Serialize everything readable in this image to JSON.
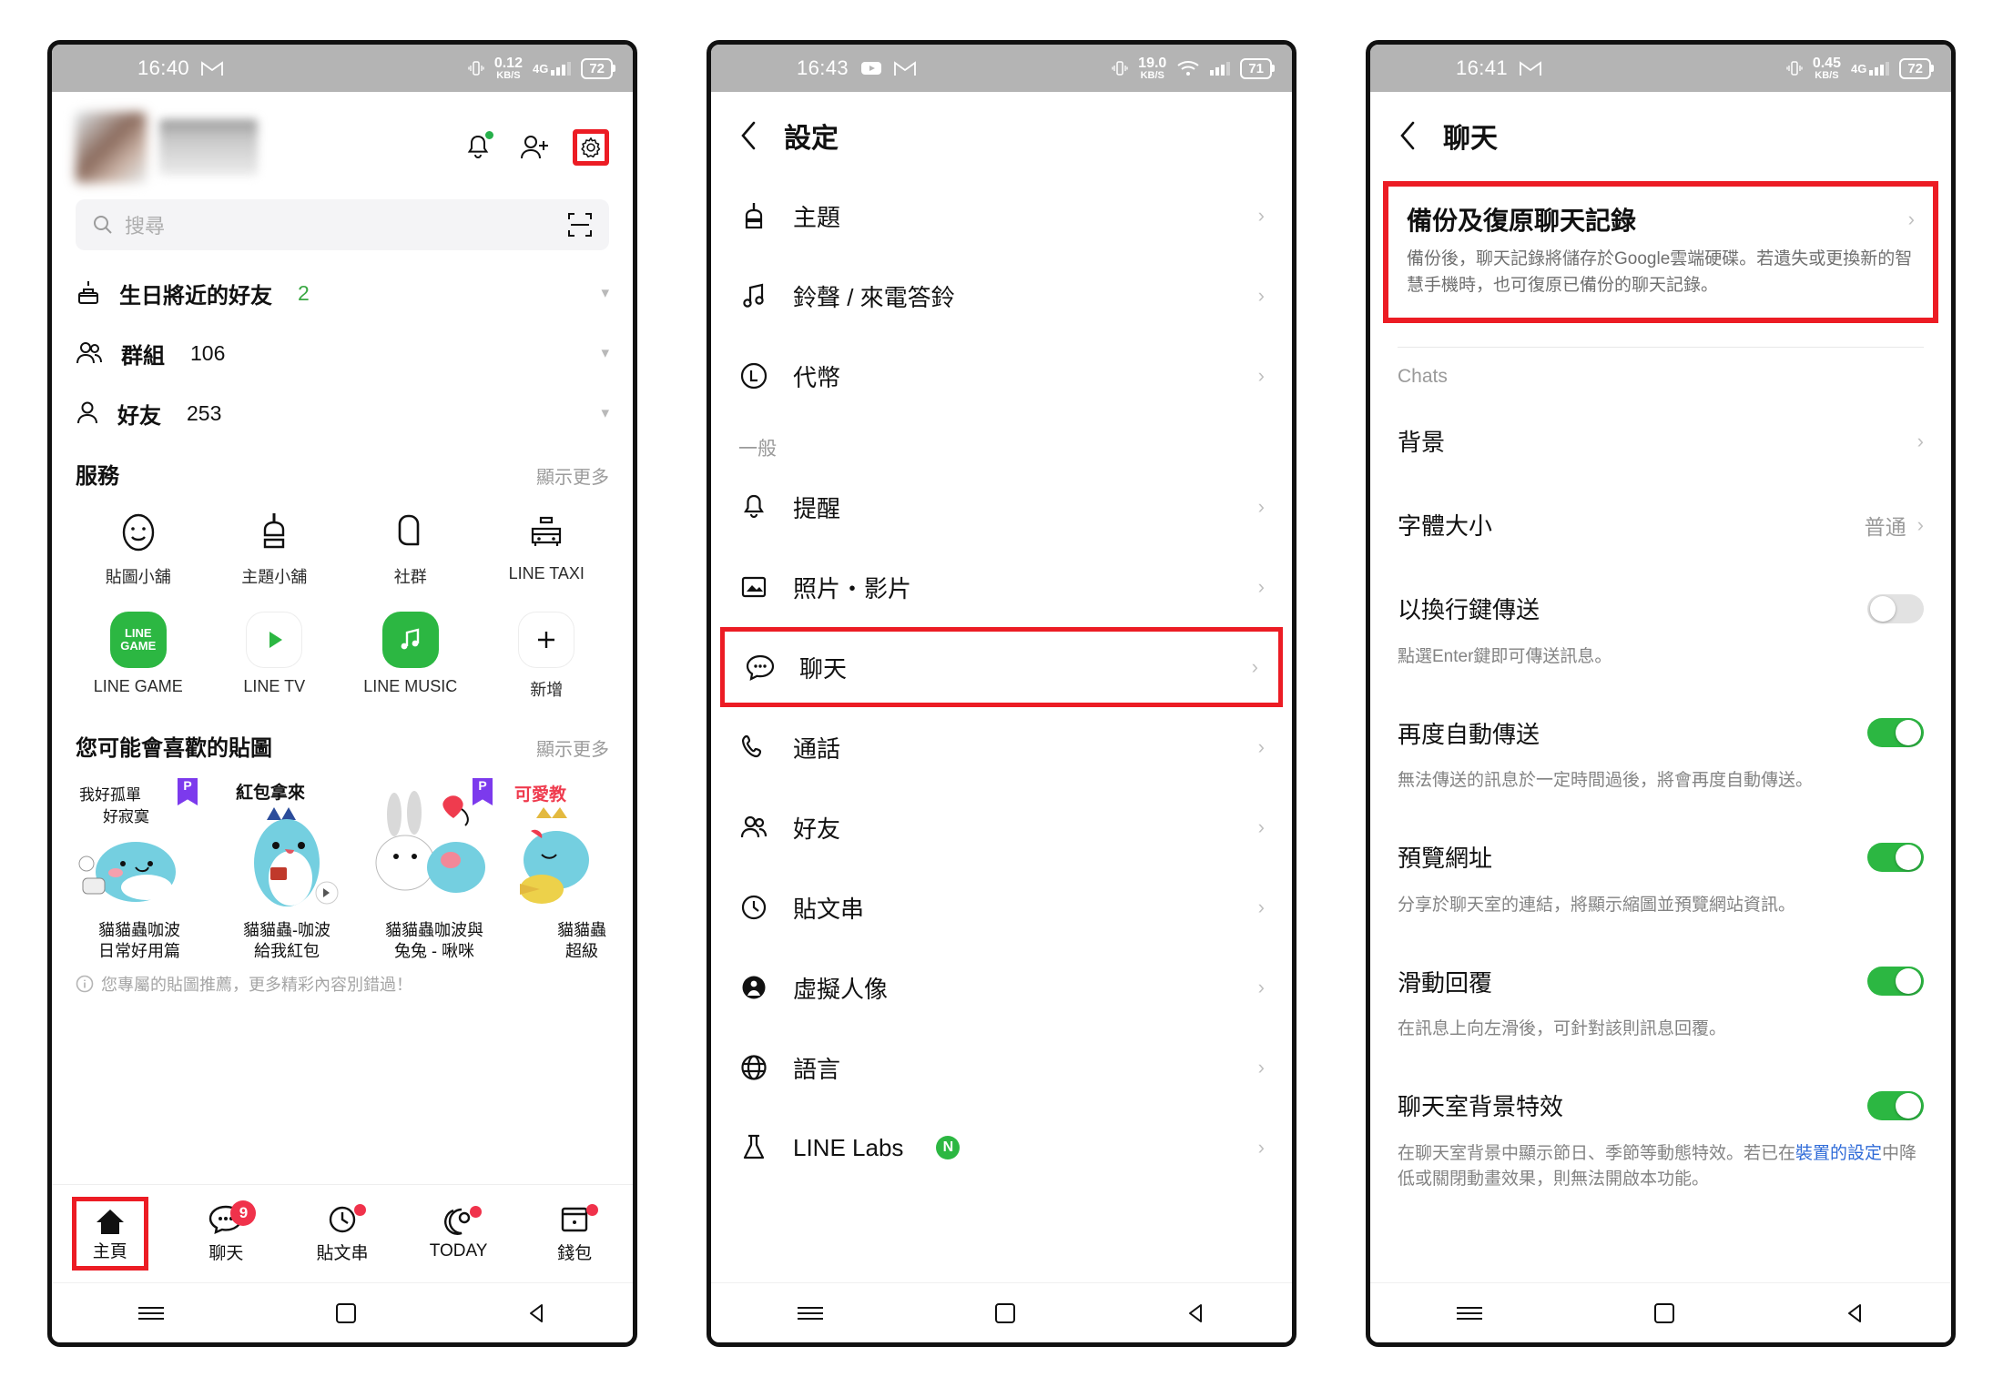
{
  "phone1": {
    "status": {
      "time": "16:40",
      "app_icon": "gmail-icon",
      "kb_value": "0.12",
      "kb_unit": "KB/S",
      "network": "4G",
      "network_sup": "+",
      "battery": "72"
    },
    "profile": {
      "bell_icon": "bell-icon",
      "add_friend_icon": "add-friend-icon",
      "settings_icon": "gear-icon"
    },
    "search": {
      "placeholder": "搜尋",
      "icon": "search-icon",
      "scan_icon": "qr-scan-icon"
    },
    "friend_rows": [
      {
        "icon": "birthday-cake-icon",
        "label": "生日將近的好友",
        "count": "2",
        "count_green": true
      },
      {
        "icon": "group-icon",
        "label": "群組",
        "count": "106",
        "count_green": false
      },
      {
        "icon": "person-icon",
        "label": "好友",
        "count": "253",
        "count_green": false
      }
    ],
    "services": {
      "title": "服務",
      "more": "顯示更多",
      "items": [
        {
          "icon": "smiley-sticker-icon",
          "label": "貼圖小舖"
        },
        {
          "icon": "brush-theme-icon",
          "label": "主題小舖"
        },
        {
          "icon": "openchat-icon",
          "label": "社群"
        },
        {
          "icon": "taxi-icon",
          "label": "LINE TAXI"
        },
        {
          "icon": "line-game-icon",
          "label": "LINE GAME",
          "badge_text": "LINE GAME"
        },
        {
          "icon": "play-icon",
          "label": "LINE TV"
        },
        {
          "icon": "music-note-icon",
          "label": "LINE MUSIC"
        },
        {
          "icon": "plus-icon",
          "label": "新增"
        }
      ]
    },
    "stickers": {
      "title": "您可能會喜歡的貼圖",
      "more": "顯示更多",
      "note": "您專屬的貼圖推薦，更多精彩內容別錯過！",
      "items": [
        {
          "name": "貓貓蟲咖波\n日常好用篇",
          "line1": "貓貓蟲咖波",
          "line2": "日常好用篇",
          "caption": "我好孤單\n好寂寞",
          "premium": true
        },
        {
          "name": "貓貓蟲-咖波\n給我紅包",
          "line1": "貓貓蟲-咖波",
          "line2": "給我紅包",
          "caption": "紅包拿來",
          "premium": false
        },
        {
          "name": "貓貓蟲咖波與\n兔兔 - 啾咪",
          "line1": "貓貓蟲咖波與",
          "line2": "兔兔 - 啾咪",
          "caption": "",
          "premium": true
        },
        {
          "name": "貓貓蟲\n超級",
          "line1": "貓貓蟲",
          "line2": "超級",
          "caption": "可愛教",
          "premium": false
        }
      ]
    },
    "bottom_nav": [
      {
        "icon": "home-icon",
        "label": "主頁",
        "active": true,
        "badge": "",
        "dot": false
      },
      {
        "icon": "chat-icon",
        "label": "聊天",
        "active": false,
        "badge": "9",
        "dot": false
      },
      {
        "icon": "timeline-icon",
        "label": "貼文串",
        "active": false,
        "badge": "",
        "dot": true
      },
      {
        "icon": "today-icon",
        "label": "TODAY",
        "active": false,
        "badge": "",
        "dot": true
      },
      {
        "icon": "wallet-icon",
        "label": "錢包",
        "active": false,
        "badge": "",
        "dot": true
      }
    ]
  },
  "phone2": {
    "status": {
      "time": "16:43",
      "app_icon_1": "youtube-icon",
      "app_icon_2": "gmail-icon",
      "kb_value": "19.0",
      "kb_unit": "KB/S",
      "network": "wifi",
      "battery": "71"
    },
    "header": {
      "back_icon": "back-chevron-icon",
      "title": "設定"
    },
    "rows": [
      {
        "icon": "brush-theme-icon",
        "label": "主題",
        "highlight": false
      },
      {
        "icon": "music-note-icon",
        "label": "鈴聲 / 來電答鈴",
        "highlight": false
      },
      {
        "icon": "coin-icon",
        "label": "代幣",
        "highlight": false
      }
    ],
    "group_label": "一般",
    "rows2": [
      {
        "icon": "bell-icon",
        "label": "提醒",
        "highlight": false
      },
      {
        "icon": "photo-icon",
        "label": "照片・影片",
        "highlight": false
      },
      {
        "icon": "chat-bubble-icon",
        "label": "聊天",
        "highlight": true
      },
      {
        "icon": "phone-icon",
        "label": "通話",
        "highlight": false
      },
      {
        "icon": "friends-icon",
        "label": "好友",
        "highlight": false
      },
      {
        "icon": "clock-icon",
        "label": "貼文串",
        "highlight": false
      },
      {
        "icon": "avatar-face-icon",
        "label": "虛擬人像",
        "highlight": false
      },
      {
        "icon": "globe-icon",
        "label": "語言",
        "highlight": false
      },
      {
        "icon": "flask-icon",
        "label": "LINE Labs",
        "highlight": false,
        "badge": "N"
      }
    ]
  },
  "phone3": {
    "status": {
      "time": "16:41",
      "app_icon": "gmail-icon",
      "kb_value": "0.45",
      "kb_unit": "KB/S",
      "network": "4G",
      "network_sup": "+",
      "battery": "72"
    },
    "header": {
      "back_icon": "back-chevron-icon",
      "title": "聊天"
    },
    "backup_card": {
      "title": "備份及復原聊天記錄",
      "desc": "備份後，聊天記錄將儲存於Google雲端硬碟。若遺失或更換新的智慧手機時，也可復原已備份的聊天記錄。",
      "chevron_icon": "right-chevron-icon"
    },
    "group_label": "Chats",
    "rows": [
      {
        "label": "背景",
        "type": "link",
        "value": "",
        "sub": ""
      },
      {
        "label": "字體大小",
        "type": "link",
        "value": "普通",
        "sub": ""
      },
      {
        "label": "以換行鍵傳送",
        "type": "toggle",
        "on": false,
        "sub": "點選Enter鍵即可傳送訊息。"
      },
      {
        "label": "再度自動傳送",
        "type": "toggle",
        "on": true,
        "sub": "無法傳送的訊息於一定時間過後，將會再度自動傳送。"
      },
      {
        "label": "預覽網址",
        "type": "toggle",
        "on": true,
        "sub": "分享於聊天室的連結，將顯示縮圖並預覽網站資訊。"
      },
      {
        "label": "滑動回覆",
        "type": "toggle",
        "on": true,
        "sub": "在訊息上向左滑後，可針對該則訊息回覆。"
      },
      {
        "label": "聊天室背景特效",
        "type": "toggle",
        "on": true,
        "sub_parts": [
          "在聊天室背景中顯示節日、季節等動態特效。若已在",
          "裝置的設定",
          "中降低或關閉動畫效果，則無法開啟本功能。"
        ]
      }
    ]
  },
  "android_nav": {
    "menu_icon": "menu-icon",
    "home_icon": "square-home-icon",
    "back_icon": "triangle-back-icon"
  },
  "colors": {
    "highlight": "#ec1c24",
    "green": "#2cb742",
    "badge_red": "#f0324b",
    "link": "#2f6bd8"
  }
}
